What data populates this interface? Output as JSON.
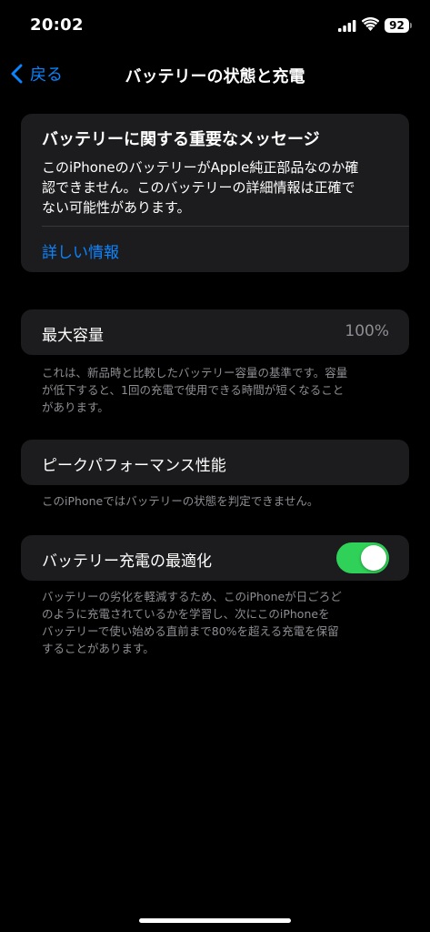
{
  "status_bar": {
    "time": "20:02",
    "battery_level": "92",
    "icons": [
      "cellular-signal-icon",
      "wifi-icon",
      "battery-icon"
    ]
  },
  "nav": {
    "back_label": "戻る",
    "title": "バッテリーの状態と充電"
  },
  "notice": {
    "title": "バッテリーに関する重要なメッセージ",
    "body_lines": [
      "このiPhoneのバッテリーがApple純正部品なのか確",
      "認できません。このバッテリーの詳細情報は正確で",
      "ない可能性があります。"
    ],
    "link": "詳しい情報"
  },
  "max_capacity": {
    "label": "最大容量",
    "value": "100%",
    "footnote_lines": [
      "これは、新品時と比較したバッテリー容量の基準です。容量",
      "が低下すると、1回の充電で使用できる時間が短くなること",
      "があります。"
    ]
  },
  "peak_performance": {
    "label": "ピークパフォーマンス性能",
    "footnote": "このiPhoneではバッテリーの状態を判定できません。"
  },
  "optimized_charging": {
    "label": "バッテリー充電の最適化",
    "enabled": true,
    "footnote_lines": [
      "バッテリーの劣化を軽減するため、このiPhoneが日ごろど",
      "のように充電されているかを学習し、次にこのiPhoneを",
      "バッテリーで使い始める直前まで80%を超える充電を保留",
      "することがあります。"
    ]
  },
  "colors": {
    "background": "#000000",
    "card": "#1c1c1e",
    "accent": "#0a84ff",
    "toggle_on": "#30d158",
    "secondary_text": "#8e8e93"
  }
}
